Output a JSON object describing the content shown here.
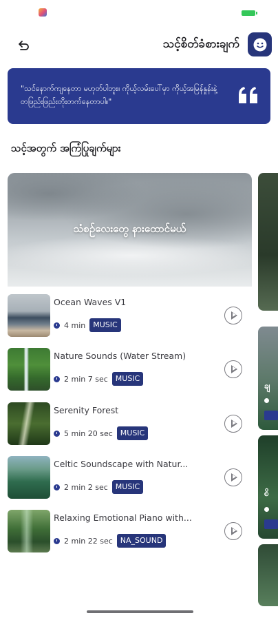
{
  "status": {
    "app_icon": "photos-app-icon",
    "battery_color": "#34c759"
  },
  "header": {
    "back_icon": "back-arrow-icon",
    "title": "သင့်စိတ်ခံစားချက်",
    "avatar_icon": "smiley-face-icon"
  },
  "quote": {
    "text": "\"သင်နောက်ကျနေတာ မဟုတ်ပါဘူး။ ကိုယ့်လမ်းပေါ်မှာ ကိုယ့်အမြန်နှုန်းနဲ့ တဖြည်းဖြည်းတိုးတက်နေတာပါ။\"",
    "icon": "quote-icon"
  },
  "section_title": "သင့်အတွက် အကြံပြုချက်များ",
  "featured": {
    "title": "သံစဥ်လေးတွေ နားထောင်မယ်"
  },
  "tracks": [
    {
      "title": "Ocean Waves V1",
      "duration": "4 min",
      "tag": "MUSIC"
    },
    {
      "title": "Nature Sounds (Water Stream)",
      "duration": "2 min 7 sec",
      "tag": "MUSIC"
    },
    {
      "title": "Serenity Forest",
      "duration": "5 min 20 sec",
      "tag": "MUSIC"
    },
    {
      "title": "Celtic Soundscape with Natur...",
      "duration": "2 min 2 sec",
      "tag": "MUSIC"
    },
    {
      "title": "Relaxing Emotional Piano with...",
      "duration": "2 min 22 sec",
      "tag": "NA_SOUND"
    }
  ],
  "colors": {
    "accent": "#2a3a8f",
    "tag_bg": "#27357a"
  }
}
